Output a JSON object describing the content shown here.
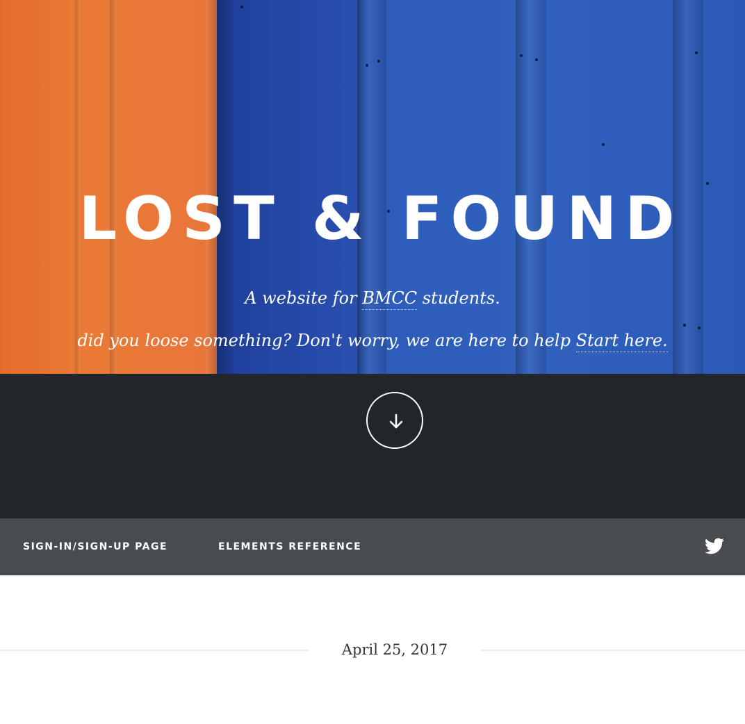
{
  "hero": {
    "title": "LOST & FOUND",
    "subtitle_prefix": "A website for ",
    "subtitle_link": "BMCC",
    "subtitle_suffix": " students.",
    "help_text": "did you loose something? Don't worry, we are here to help ",
    "help_link": "Start here."
  },
  "scroll_button": {
    "icon": "arrow-down-icon"
  },
  "nav": {
    "items": [
      {
        "label": "SIGN-IN/SIGN-UP PAGE"
      },
      {
        "label": "ELEMENTS REFERENCE"
      }
    ],
    "social_icon": "twitter-icon"
  },
  "post": {
    "date": "April 25, 2017"
  },
  "colors": {
    "hero_orange": "#e8763a",
    "hero_blue": "#2d5bb9",
    "dark_band": "#22252a",
    "nav_bar": "#484b4f",
    "text_dark": "#33363b",
    "rule": "#ebebeb"
  }
}
